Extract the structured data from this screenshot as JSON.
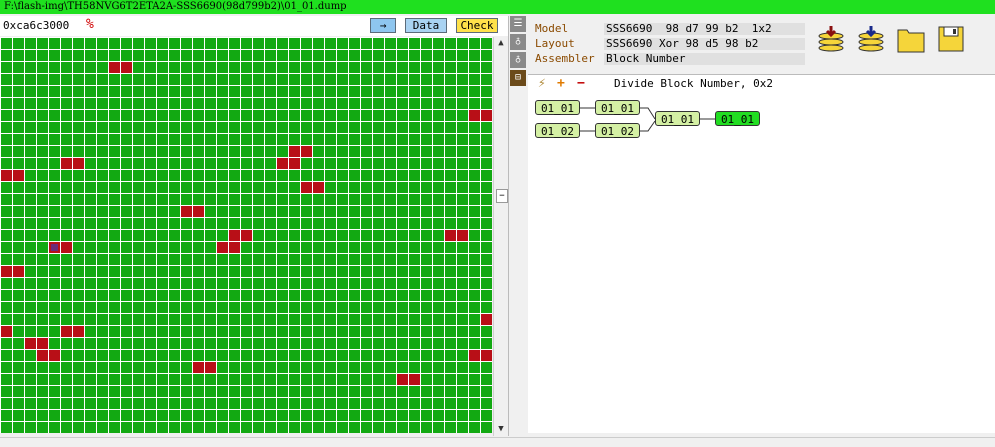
{
  "window": {
    "title": "F:\\flash-img\\TH58NVG6T2ETA2A-SSS6690(98d799b2)\\01_01.dump"
  },
  "left_toolbar": {
    "address": "0xca6c3000",
    "percent_icon": "%",
    "arrow_button": "→",
    "data_button": "Data",
    "check_button": "Check"
  },
  "block_map": {
    "cols": 41,
    "rows": 33,
    "good_color": "#12a912",
    "bad_color": "#b80f17",
    "selected_color": "#6b2a7a",
    "bad_cells": [
      [
        2,
        9
      ],
      [
        2,
        10
      ],
      [
        6,
        39
      ],
      [
        6,
        40
      ],
      [
        9,
        24
      ],
      [
        9,
        25
      ],
      [
        10,
        5
      ],
      [
        10,
        6
      ],
      [
        10,
        23
      ],
      [
        10,
        24
      ],
      [
        11,
        0
      ],
      [
        11,
        1
      ],
      [
        12,
        25
      ],
      [
        12,
        26
      ],
      [
        14,
        15
      ],
      [
        14,
        16
      ],
      [
        16,
        19
      ],
      [
        16,
        20
      ],
      [
        16,
        37
      ],
      [
        16,
        38
      ],
      [
        17,
        4
      ],
      [
        17,
        5
      ],
      [
        17,
        18
      ],
      [
        17,
        19
      ],
      [
        19,
        0
      ],
      [
        19,
        1
      ],
      [
        23,
        40
      ],
      [
        24,
        0
      ],
      [
        24,
        5
      ],
      [
        24,
        6
      ],
      [
        25,
        2
      ],
      [
        25,
        3
      ],
      [
        26,
        3
      ],
      [
        26,
        4
      ],
      [
        26,
        39
      ],
      [
        26,
        40
      ],
      [
        27,
        16
      ],
      [
        27,
        17
      ],
      [
        28,
        33
      ],
      [
        28,
        34
      ]
    ],
    "selected_cells": [
      [
        17,
        4
      ]
    ]
  },
  "side_tabs": [
    {
      "icon": "list-icon",
      "glyph": "☰"
    },
    {
      "icon": "bulb-icon",
      "glyph": "♁"
    },
    {
      "icon": "bulb2-icon",
      "glyph": "♁"
    },
    {
      "icon": "tree-icon",
      "glyph": "⊟"
    }
  ],
  "properties": [
    {
      "label": "Model",
      "value": "SSS6690  98 d7 99 b2  1x2"
    },
    {
      "label": "Layout",
      "value": "SSS6690 Xor 98 d5 98 b2"
    },
    {
      "label": "Assembler",
      "value": "Block Number"
    }
  ],
  "toolbar_icons": [
    {
      "name": "import-stack-icon"
    },
    {
      "name": "export-stack-icon"
    },
    {
      "name": "folder-icon"
    },
    {
      "name": "save-disk-icon"
    }
  ],
  "graph_toolbar": {
    "wand": "⚡",
    "add": "+",
    "remove": "−",
    "title": "Divide Block Number, 0x2"
  },
  "graph": {
    "nodes": [
      {
        "id": "a1",
        "label": "01_01"
      },
      {
        "id": "a2",
        "label": "01_02"
      },
      {
        "id": "b1",
        "label": "01_01"
      },
      {
        "id": "b2",
        "label": "01_02"
      },
      {
        "id": "c1",
        "label": "01_01"
      },
      {
        "id": "d1",
        "label": "01_01"
      }
    ]
  }
}
